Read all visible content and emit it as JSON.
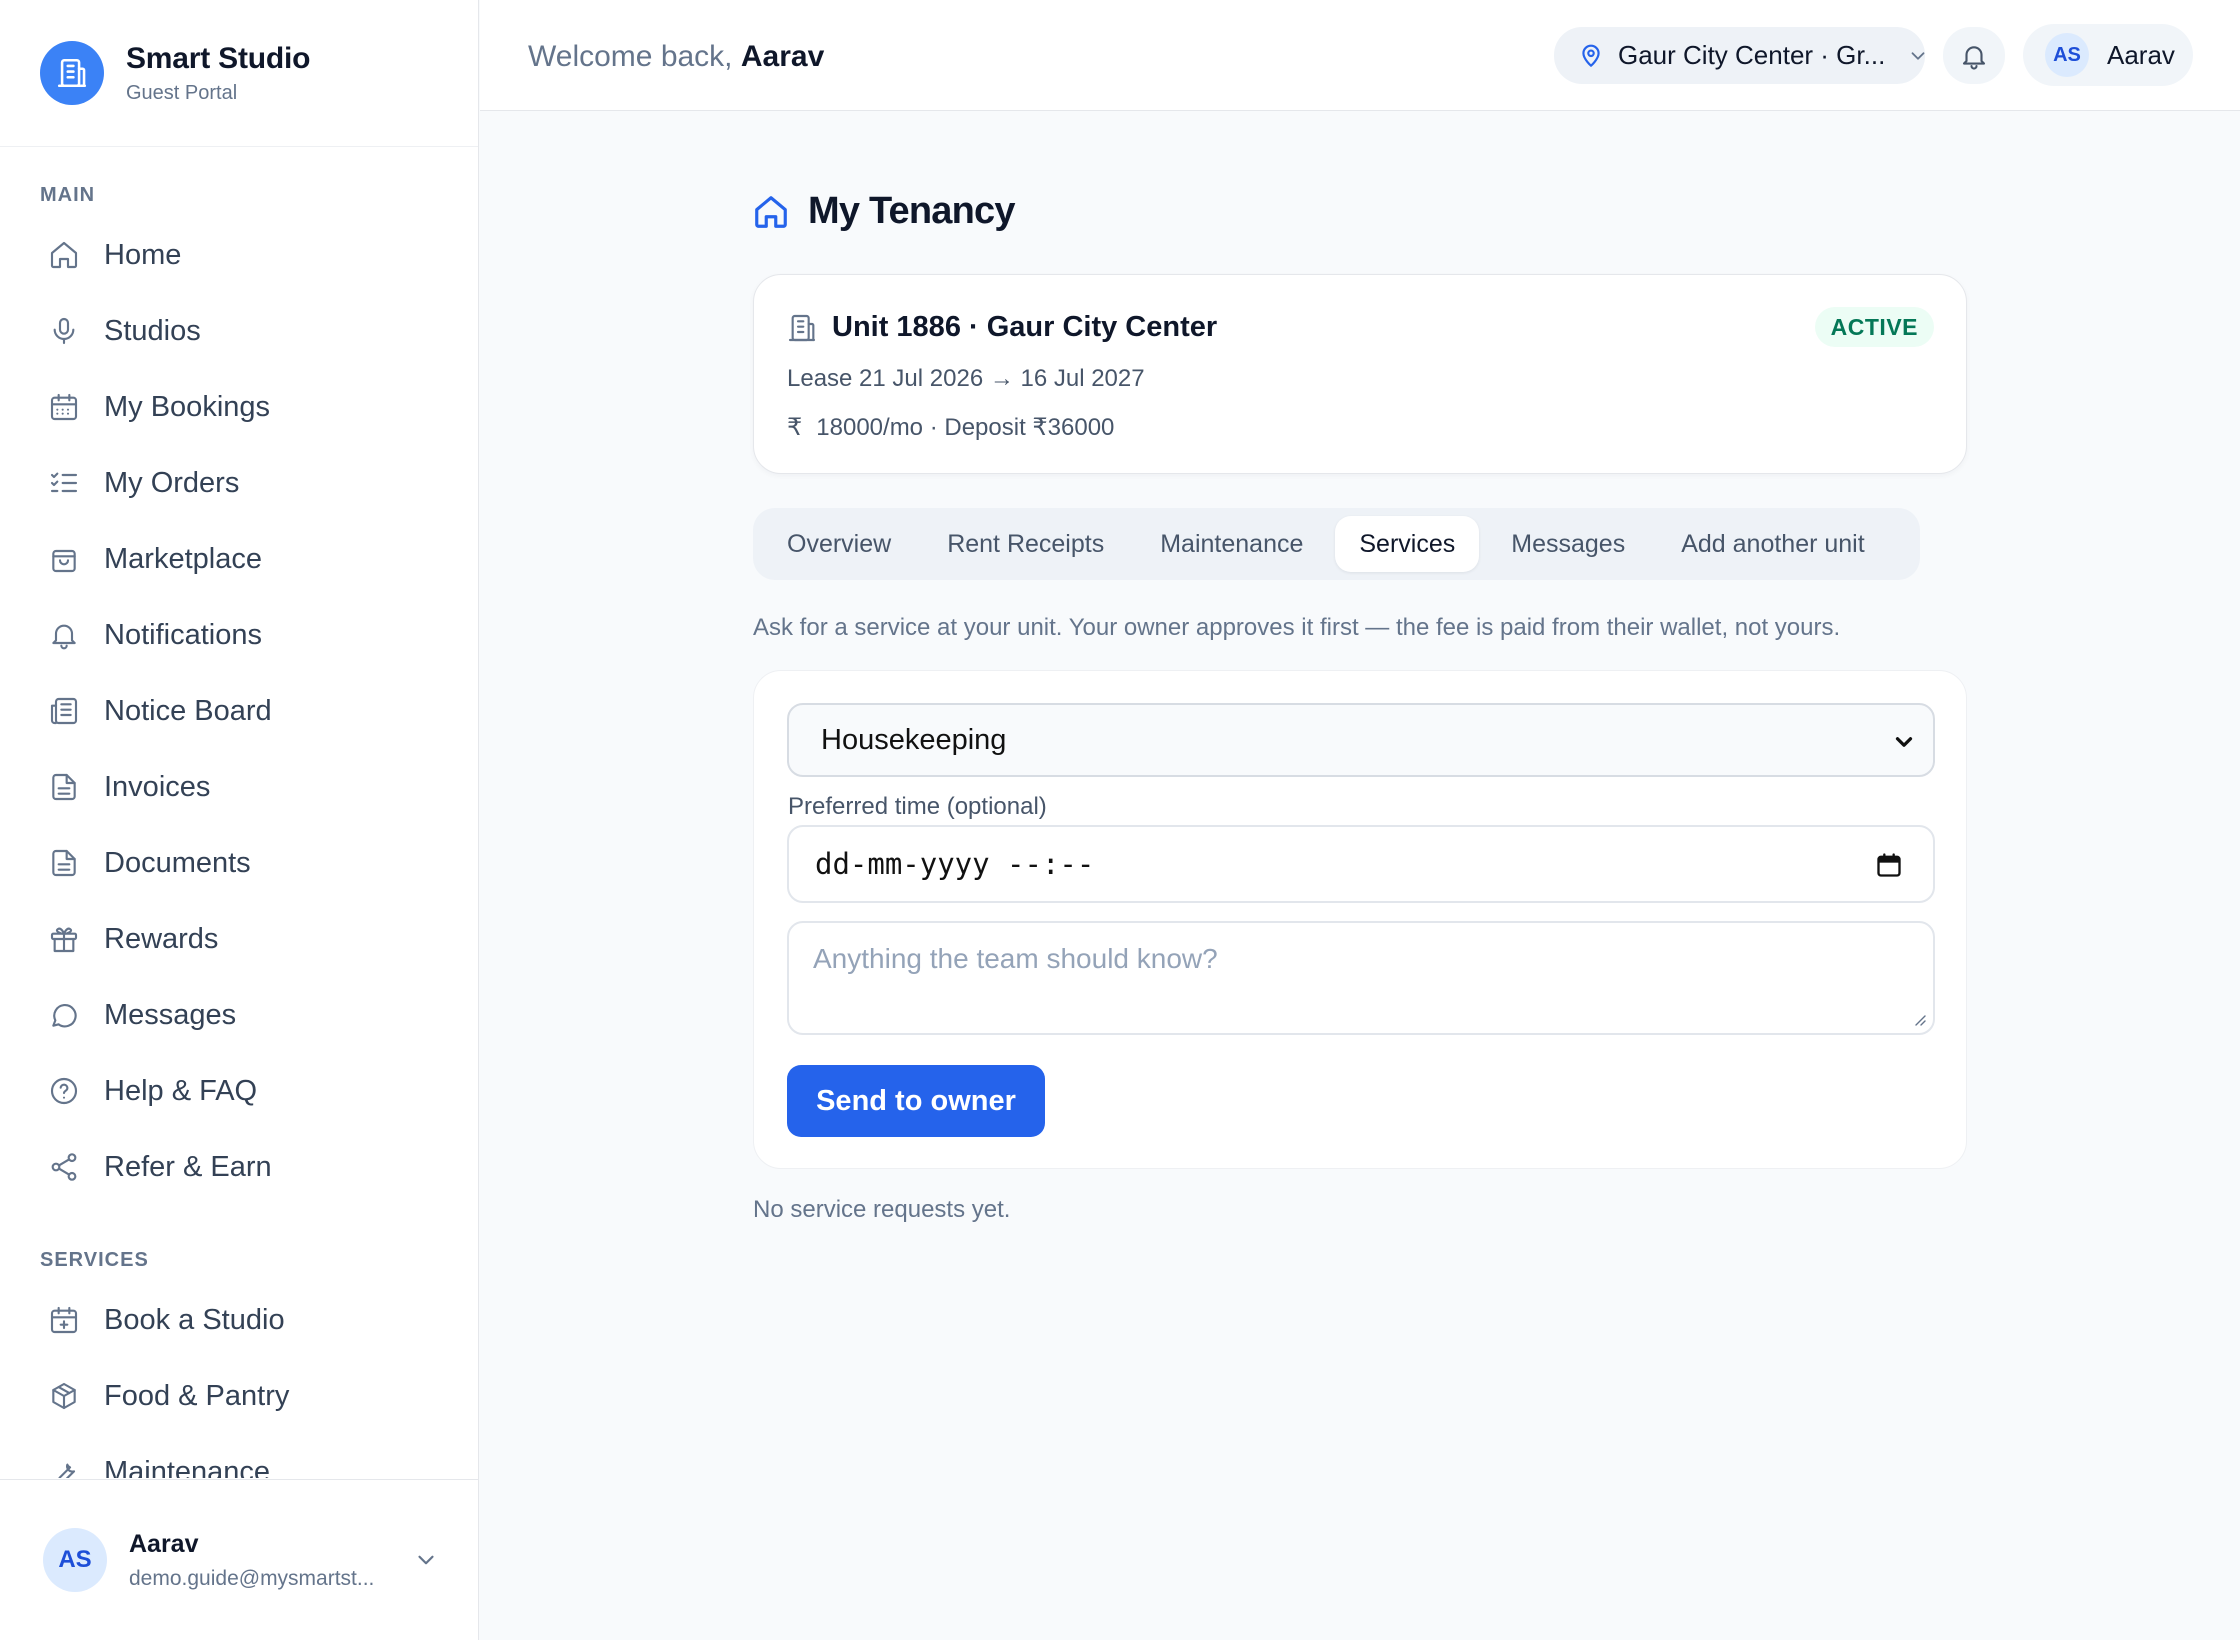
{
  "brand": {
    "name": "Smart Studio",
    "subtitle": "Guest Portal"
  },
  "sidebar": {
    "sections": [
      {
        "title": "MAIN",
        "items": [
          {
            "label": "Home",
            "icon": "home-icon"
          },
          {
            "label": "Studios",
            "icon": "microphone-icon"
          },
          {
            "label": "My Bookings",
            "icon": "calendar-icon"
          },
          {
            "label": "My Orders",
            "icon": "list-check-icon"
          },
          {
            "label": "Marketplace",
            "icon": "shopping-bag-icon"
          },
          {
            "label": "Notifications",
            "icon": "bell-icon"
          },
          {
            "label": "Notice Board",
            "icon": "newspaper-icon"
          },
          {
            "label": "Invoices",
            "icon": "file-icon"
          },
          {
            "label": "Documents",
            "icon": "file-icon"
          },
          {
            "label": "Rewards",
            "icon": "gift-icon"
          },
          {
            "label": "Messages",
            "icon": "chat-icon"
          },
          {
            "label": "Help & FAQ",
            "icon": "help-circle-icon"
          },
          {
            "label": "Refer & Earn",
            "icon": "share-icon"
          }
        ]
      },
      {
        "title": "SERVICES",
        "items": [
          {
            "label": "Book a Studio",
            "icon": "calendar-plus-icon"
          },
          {
            "label": "Food & Pantry",
            "icon": "package-icon"
          },
          {
            "label": "Maintenance",
            "icon": "wrench-icon"
          }
        ]
      }
    ],
    "footer": {
      "initials": "AS",
      "name": "Aarav",
      "email": "demo.guide@mysmartst..."
    }
  },
  "header": {
    "welcome_prefix": "Welcome back,",
    "welcome_name": "Aarav",
    "location": "Gaur City Center · Gr...",
    "user_initials": "AS",
    "user_name": "Aarav"
  },
  "main": {
    "title": "My Tenancy",
    "unit": {
      "title": "Unit 1886 · Gaur City Center",
      "status": "ACTIVE",
      "lease": "Lease 21 Jul 2026 → 16 Jul 2027",
      "rent_symbol": "₹",
      "rent": "18000/mo · Deposit ₹36000"
    },
    "tabs": [
      {
        "label": "Overview",
        "active": false
      },
      {
        "label": "Rent Receipts",
        "active": false
      },
      {
        "label": "Maintenance",
        "active": false
      },
      {
        "label": "Services",
        "active": true
      },
      {
        "label": "Messages",
        "active": false
      },
      {
        "label": "Add another unit",
        "active": false
      }
    ],
    "helper_text": "Ask for a service at your unit. Your owner approves it first — the fee is paid from their wallet, not yours.",
    "form": {
      "service_selected": "Housekeeping",
      "time_label": "Preferred time (optional)",
      "time_value": "dd-mm-yyyy --:--",
      "notes_placeholder": "Anything the team should know?",
      "submit_label": "Send to owner"
    },
    "empty_text": "No service requests yet."
  },
  "colors": {
    "accent": "#2563eb",
    "brand_logo": "#3b82f6",
    "active_badge_bg": "#ecfdf5",
    "active_badge_text": "#047857",
    "page_bg": "#f8fafc"
  }
}
